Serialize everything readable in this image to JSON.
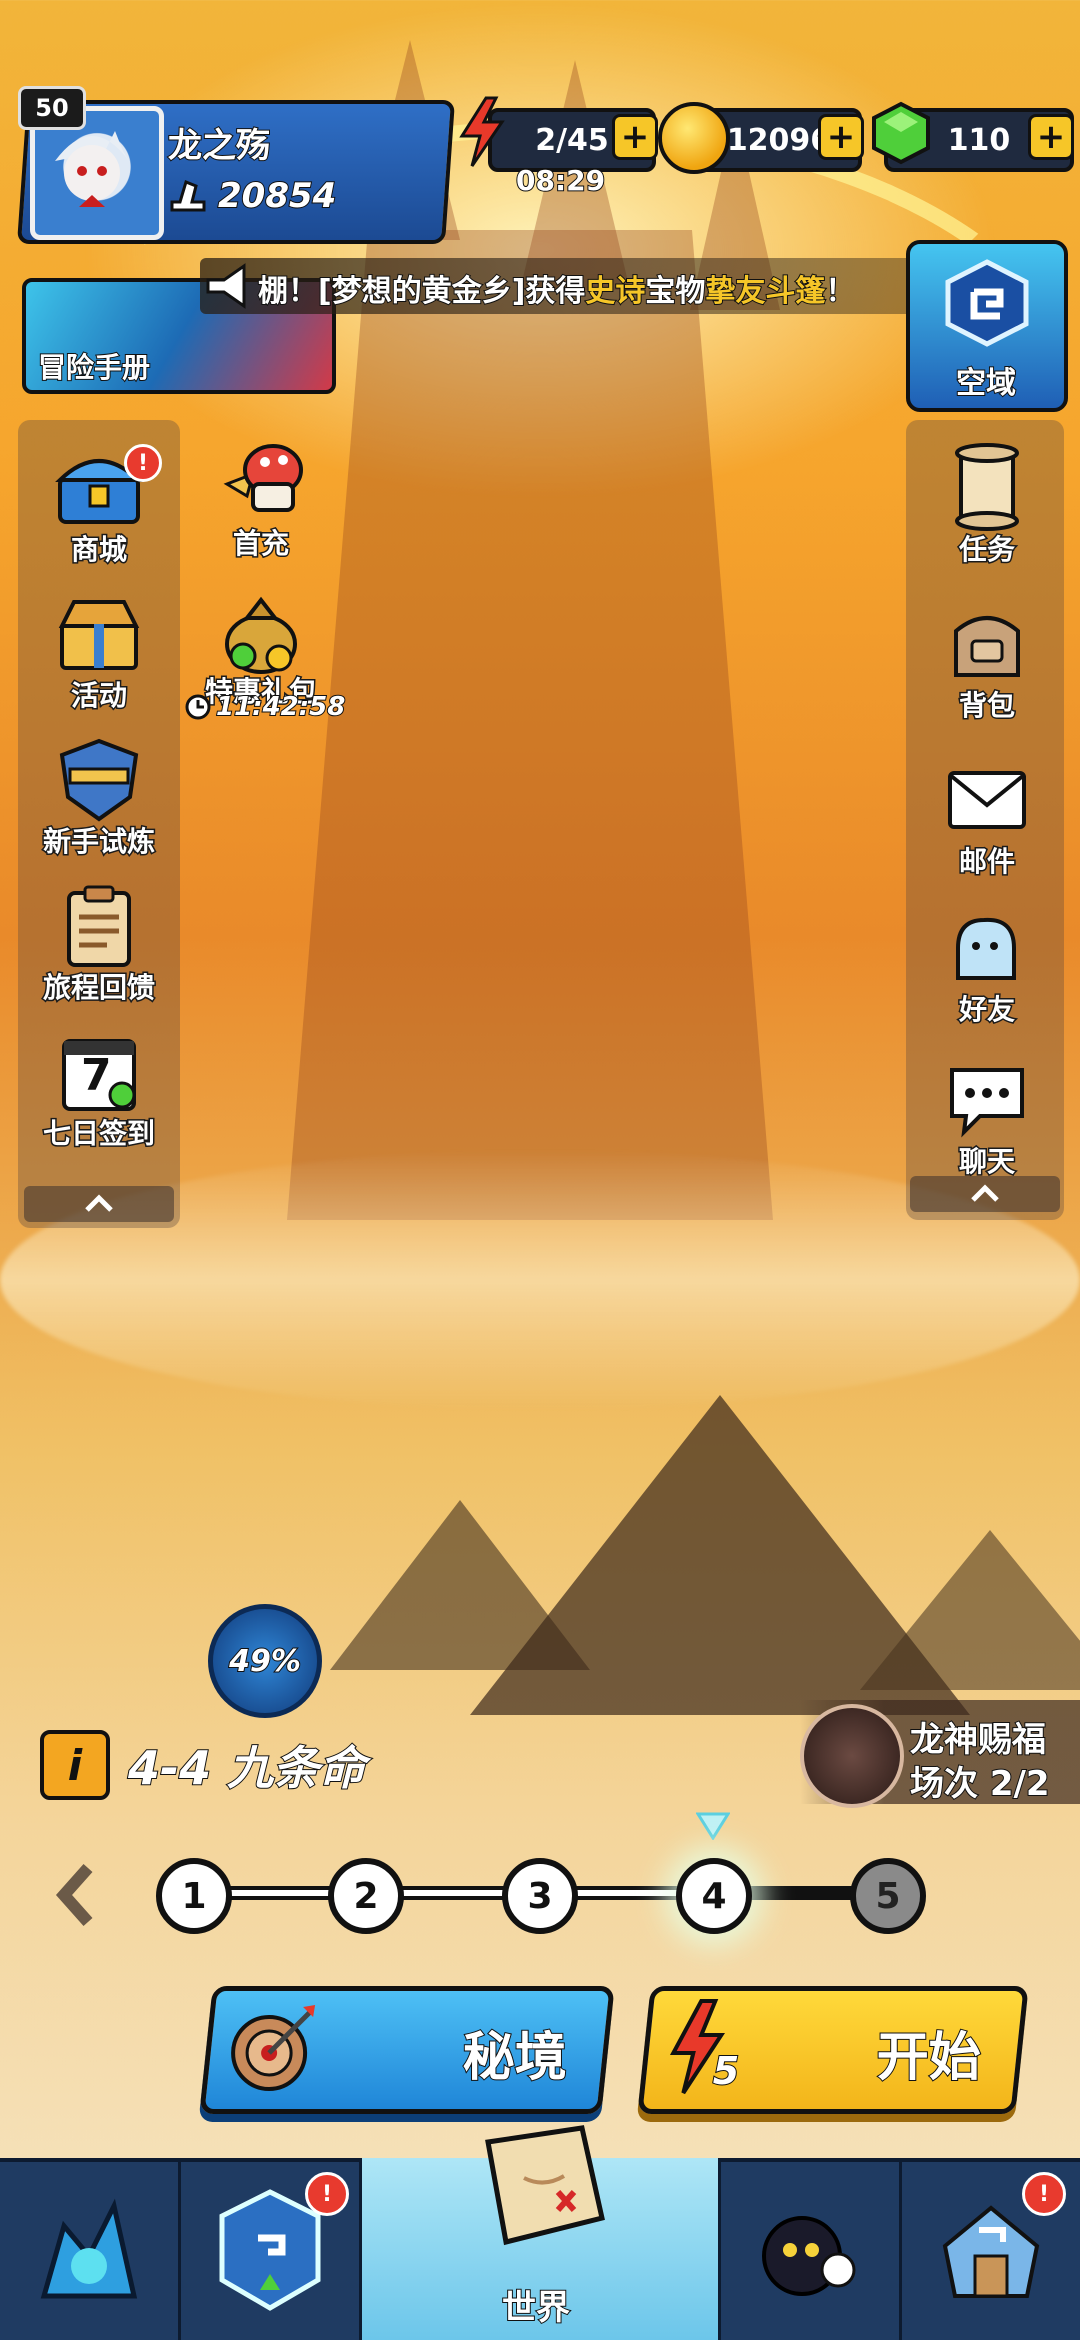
{
  "player": {
    "level": "50",
    "name": "龙之殇",
    "power": "20854"
  },
  "resources": {
    "energy": "2/45",
    "energy_timer": "08:29",
    "gold": "12096",
    "gems": "110"
  },
  "adventure_manual": "冒险手册",
  "announcement": {
    "prefix": "棚！[梦想的黄金乡]获得",
    "rarity": "史诗",
    "mid": "宝物",
    "item": "挚友斗篷",
    "suffix": "！"
  },
  "realm_button": "空域",
  "left_menu": [
    {
      "label": "商城",
      "icon": "treasure-chest-icon"
    },
    {
      "label": "活动",
      "icon": "gift-box-icon"
    },
    {
      "label": "新手试炼",
      "icon": "shield-icon"
    },
    {
      "label": "旅程回馈",
      "icon": "clipboard-icon"
    },
    {
      "label": "七日签到",
      "icon": "calendar-icon",
      "day": "7"
    }
  ],
  "promo": {
    "first_recharge": "首充",
    "gift_pack": "特惠礼包",
    "gift_timer": "11:42:58"
  },
  "right_menu": [
    {
      "label": "任务",
      "icon": "scroll-icon"
    },
    {
      "label": "背包",
      "icon": "backpack-icon"
    },
    {
      "label": "邮件",
      "icon": "mail-icon"
    },
    {
      "label": "好友",
      "icon": "friends-icon"
    },
    {
      "label": "聊天",
      "icon": "chat-icon"
    }
  ],
  "progress": "49%",
  "stage": {
    "info_icon": "i",
    "name": "4-4 九条命",
    "nodes": [
      "1",
      "2",
      "3",
      "4",
      "5"
    ],
    "current": 4
  },
  "dragon_blessing": {
    "title": "龙神赐福",
    "count": "场次 2/2"
  },
  "buttons": {
    "secret_realm": "秘境",
    "start": "开始",
    "start_cost": "5"
  },
  "bottom_nav": {
    "world": "世界"
  },
  "colors": {
    "accent_yellow": "#f6c628",
    "accent_blue": "#2d9be0",
    "panel_dark": "#1f2a3f",
    "badge_red": "#e83a2e"
  }
}
